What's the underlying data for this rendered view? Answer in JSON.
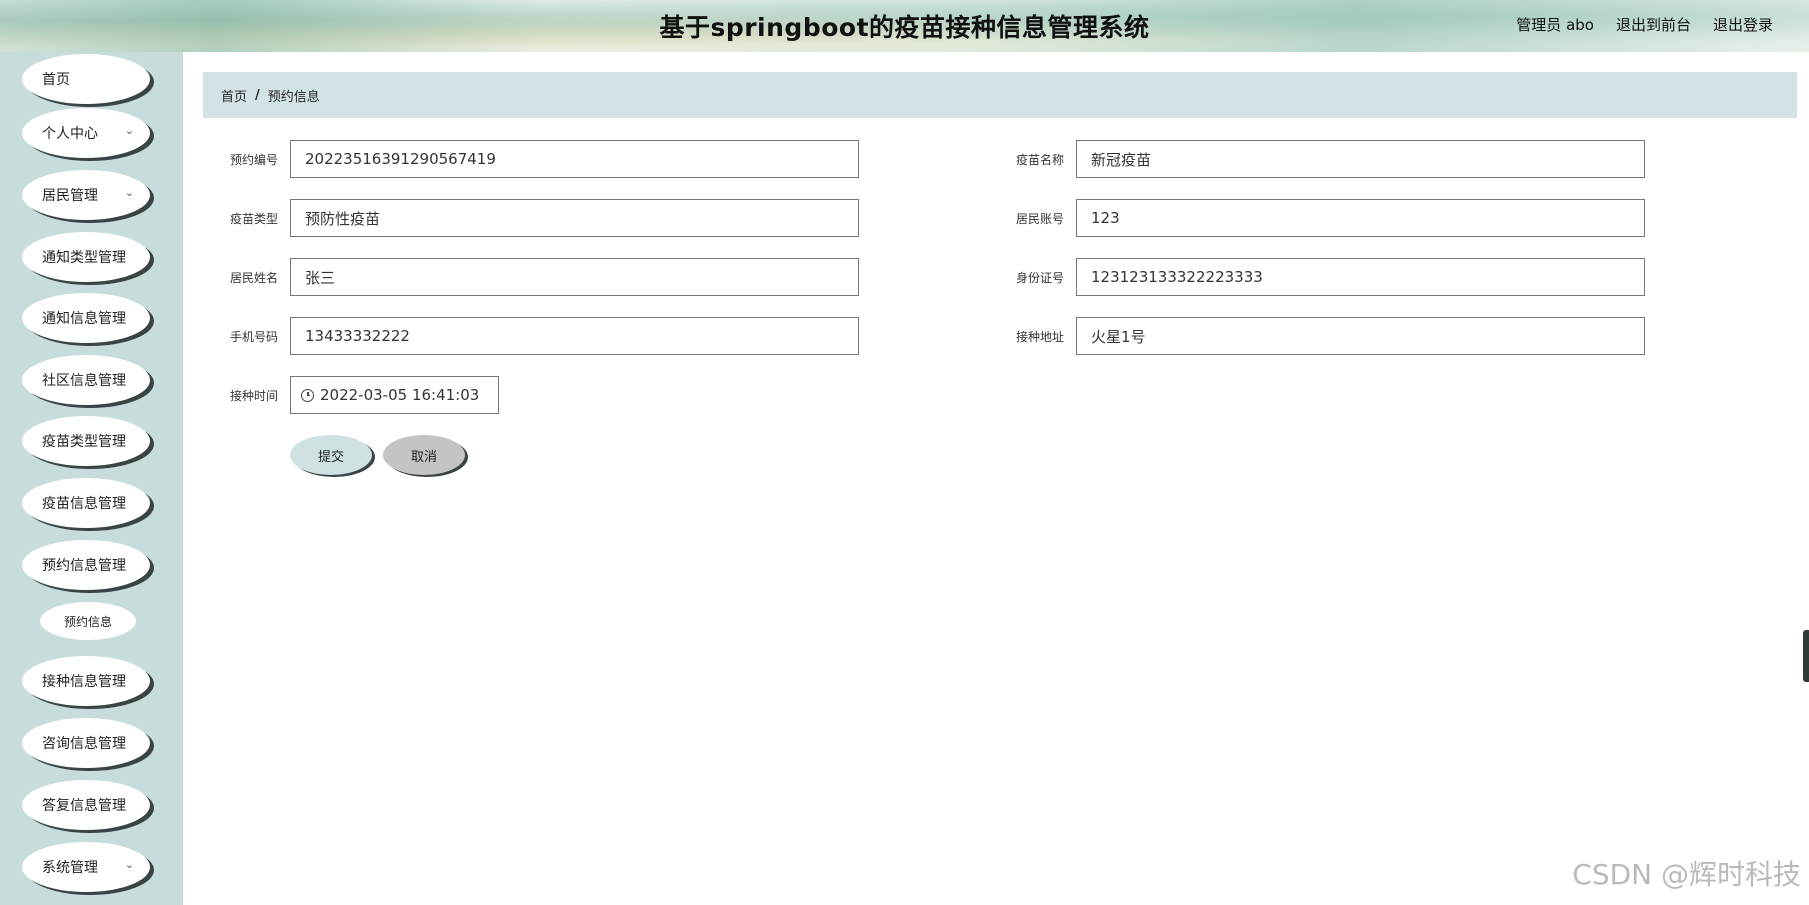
{
  "header": {
    "title": "基于springboot的疫苗接种信息管理系统",
    "user": "管理员 abo",
    "to_front": "退出到前台",
    "logout": "退出登录"
  },
  "sidebar": {
    "items": [
      {
        "label": "首页",
        "has_arrow": false
      },
      {
        "label": "个人中心",
        "has_arrow": true
      },
      {
        "label": "居民管理",
        "has_arrow": true
      },
      {
        "label": "通知类型管理",
        "has_arrow": false
      },
      {
        "label": "通知信息管理",
        "has_arrow": false
      },
      {
        "label": "社区信息管理",
        "has_arrow": false
      },
      {
        "label": "疫苗类型管理",
        "has_arrow": false
      },
      {
        "label": "疫苗信息管理",
        "has_arrow": false
      },
      {
        "label": "预约信息管理",
        "has_arrow": false
      },
      {
        "label": "接种信息管理",
        "has_arrow": false
      },
      {
        "label": "咨询信息管理",
        "has_arrow": false
      },
      {
        "label": "答复信息管理",
        "has_arrow": false
      },
      {
        "label": "系统管理",
        "has_arrow": true
      }
    ],
    "sub_item": "预约信息",
    "chevron": "chevron-down-icon"
  },
  "breadcrumb": {
    "home": "首页",
    "separator": "/",
    "current": "预约信息"
  },
  "form": {
    "booking_no": {
      "label": "预约编号",
      "value": "20223516391290567419"
    },
    "vaccine_name": {
      "label": "疫苗名称",
      "value": "新冠疫苗"
    },
    "vaccine_type": {
      "label": "疫苗类型",
      "value": "预防性疫苗"
    },
    "resident_account": {
      "label": "居民账号",
      "value": "123"
    },
    "resident_name": {
      "label": "居民姓名",
      "value": "张三"
    },
    "id_number": {
      "label": "身份证号",
      "value": "123123133322223333"
    },
    "phone": {
      "label": "手机号码",
      "value": "13433332222"
    },
    "address": {
      "label": "接种地址",
      "value": "火星1号"
    },
    "time": {
      "label": "接种时间",
      "value": "2022-03-05 16:41:03",
      "icon": "clock-icon"
    },
    "submit": "提交",
    "cancel": "取消"
  },
  "watermark": "CSDN @辉时科技"
}
